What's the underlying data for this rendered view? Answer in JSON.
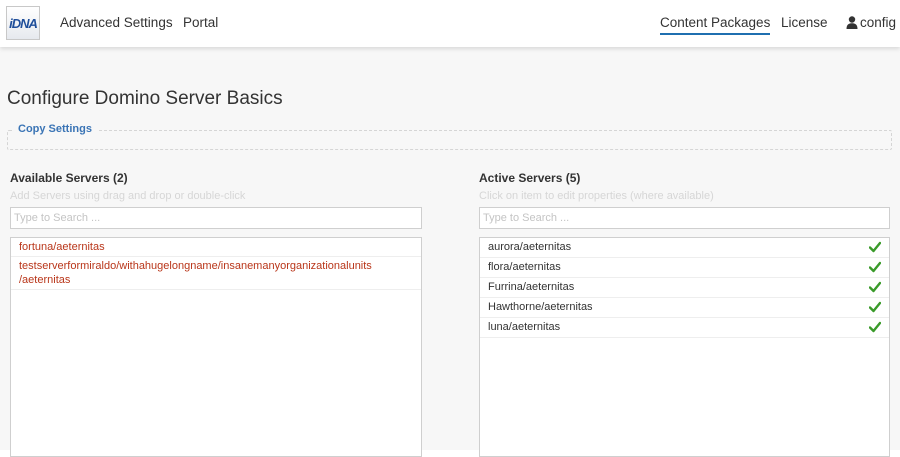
{
  "nav": {
    "logo_text": "iDNA",
    "links": {
      "advanced": "Advanced Settings",
      "portal": "Portal",
      "content": "Content Packages",
      "license": "License",
      "user": "config"
    },
    "active_color": "#1f6fb0"
  },
  "page": {
    "title": "Configure Domino Server Basics",
    "copy_settings": "Copy Settings"
  },
  "available": {
    "title": "Available Servers (2)",
    "hint": "Add Servers using drag and drop or double-click",
    "search_placeholder": "Type to Search ...",
    "items": [
      "fortuna/aeternitas",
      "testserverformiraldo/withahugelongname/insanemanyorganizationalunits",
      "/aeternitas"
    ],
    "item_color": "#b9361a"
  },
  "active": {
    "title": "Active Servers (5)",
    "hint": "Click on item to edit properties (where available)",
    "search_placeholder": "Type to Search ...",
    "items": [
      "aurora/aeternitas",
      "flora/aeternitas",
      "Furrina/aeternitas",
      "Hawthorne/aeternitas",
      "luna/aeternitas"
    ],
    "status_icon": "check-icon",
    "check_color": "#3a9a2a"
  }
}
